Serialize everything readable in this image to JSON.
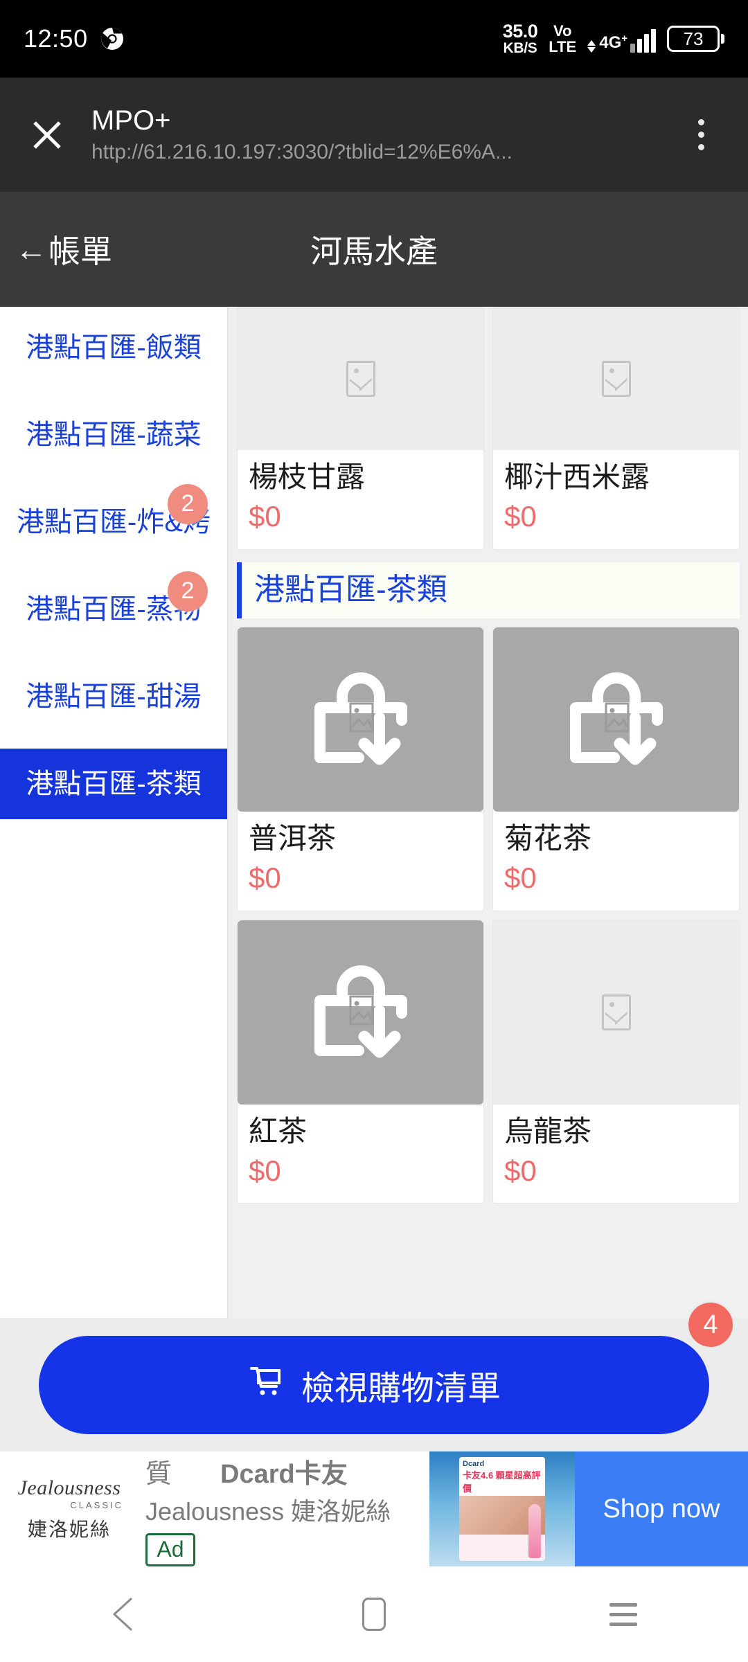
{
  "status_bar": {
    "clock": "12:50",
    "browser_icon": "chrome-icon",
    "net_speed_value": "35.0",
    "net_speed_unit": "KB/S",
    "volte_line1": "Vo",
    "volte_line2": "LTE",
    "network_type": "4G",
    "network_type_sup": "+",
    "battery_level": "73"
  },
  "custom_tab": {
    "close_icon": "close-icon",
    "title": "MPO+",
    "url": "http://61.216.10.197:3030/?tblid=12%E6%A...",
    "menu_icon": "overflow-menu-icon"
  },
  "app_header": {
    "back_arrow": "←",
    "back_label": "帳單",
    "title": "河馬水產"
  },
  "sidebar": {
    "categories": [
      {
        "label": "港點百匯-飯類",
        "badge": "",
        "selected": false
      },
      {
        "label": "港點百匯-蔬菜",
        "badge": "",
        "selected": false
      },
      {
        "label": "港點百匯-炸&烤",
        "badge": "2",
        "selected": false
      },
      {
        "label": "港點百匯-蒸物",
        "badge": "2",
        "selected": false
      },
      {
        "label": "港點百匯-甜湯",
        "badge": "",
        "selected": false
      },
      {
        "label": "港點百匯-茶類",
        "badge": "",
        "selected": true
      }
    ]
  },
  "menu": {
    "row_top": [
      {
        "name": "楊枝甘露",
        "price": "$0",
        "thumb": "image-placeholder-icon"
      },
      {
        "name": "椰汁西米露",
        "price": "$0",
        "thumb": "image-placeholder-icon"
      }
    ],
    "section_title": "港點百匯-茶類",
    "row_tea_1": [
      {
        "name": "普洱茶",
        "price": "$0",
        "thumb": "bag-download-icon"
      },
      {
        "name": "菊花茶",
        "price": "$0",
        "thumb": "bag-download-icon"
      }
    ],
    "row_tea_2": [
      {
        "name": "紅茶",
        "price": "$0",
        "thumb": "bag-download-icon"
      },
      {
        "name": "烏龍茶",
        "price": "$0",
        "thumb": "image-placeholder-icon"
      }
    ]
  },
  "cart_bar": {
    "icon": "shopping-cart-icon",
    "label": "檢視購物清單",
    "badge": "4"
  },
  "ad": {
    "logo_brand": "Jealousness",
    "logo_classic": "CLASSIC",
    "logo_cn": "婕洛妮絲",
    "headline_frag": "質",
    "headline_main": "Dcard卡友",
    "subline": "Jealousness 婕洛妮絲",
    "ad_tag": "Ad",
    "creative_top": "Dcard",
    "creative_red": "卡友4.6 顆星超高評價",
    "cta": "Shop now"
  },
  "nav_bar": {
    "back": "back-triangle-icon",
    "home": "home-pill-icon",
    "recents": "recents-lines-icon"
  },
  "colors": {
    "accent_blue": "#1534dc",
    "price_red": "#ef6b6b",
    "badge_salmon": "#f08b80",
    "cart_badge": "#f2695f",
    "header_gray": "#3a3a3a"
  }
}
